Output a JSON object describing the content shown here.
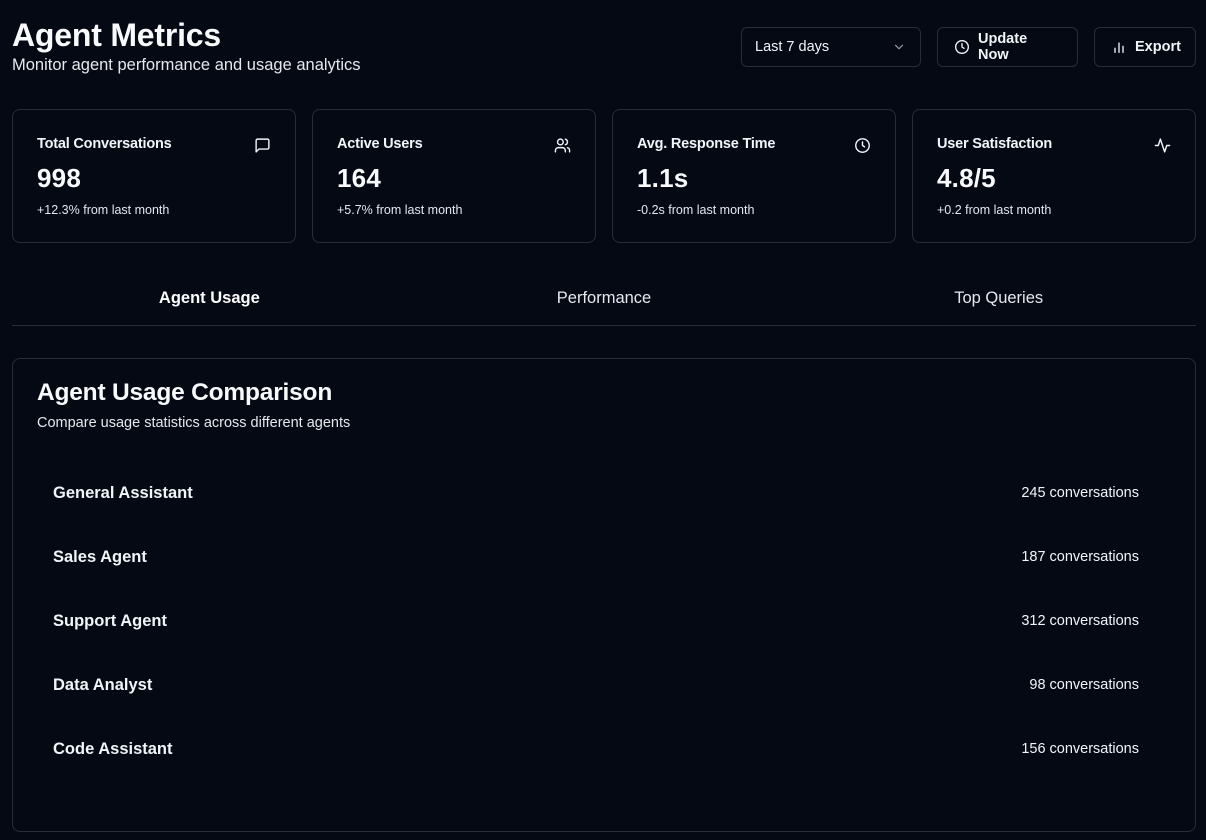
{
  "header": {
    "title": "Agent Metrics",
    "subtitle": "Monitor agent performance and usage analytics"
  },
  "controls": {
    "range_select": {
      "value": "Last 7 days",
      "icon": "chevron-down-icon"
    },
    "update_button": {
      "label": "Update Now",
      "icon": "clock-icon"
    },
    "export_button": {
      "label": "Export",
      "icon": "bar-chart-icon"
    }
  },
  "stats": [
    {
      "label": "Total Conversations",
      "value": "998",
      "change": "+12.3% from last month",
      "icon": "message-square-icon"
    },
    {
      "label": "Active Users",
      "value": "164",
      "change": "+5.7% from last month",
      "icon": "users-icon"
    },
    {
      "label": "Avg. Response Time",
      "value": "1.1s",
      "change": "-0.2s from last month",
      "icon": "clock-icon"
    },
    {
      "label": "User Satisfaction",
      "value": "4.8/5",
      "change": "+0.2 from last month",
      "icon": "activity-icon"
    }
  ],
  "tabs": [
    {
      "label": "Agent Usage",
      "active": true
    },
    {
      "label": "Performance",
      "active": false
    },
    {
      "label": "Top Queries",
      "active": false
    }
  ],
  "usage": {
    "title": "Agent Usage Comparison",
    "subtitle": "Compare usage statistics across different agents",
    "agents": [
      {
        "name": "General Assistant",
        "count": "245 conversations"
      },
      {
        "name": "Sales Agent",
        "count": "187 conversations"
      },
      {
        "name": "Support Agent",
        "count": "312 conversations"
      },
      {
        "name": "Data Analyst",
        "count": "98 conversations"
      },
      {
        "name": "Code Assistant",
        "count": "156 conversations"
      }
    ]
  }
}
